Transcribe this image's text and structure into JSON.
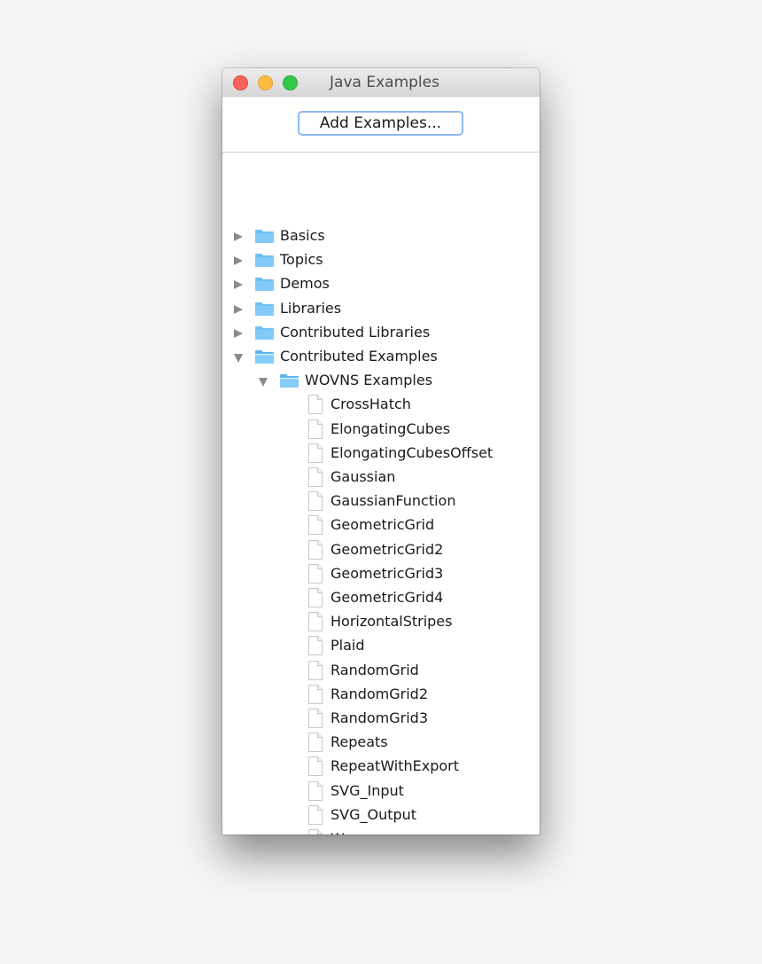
{
  "window": {
    "title": "Java Examples"
  },
  "toolbar": {
    "add_examples_label": "Add Examples..."
  },
  "tree": {
    "roots": [
      {
        "label": "Basics",
        "expanded": false
      },
      {
        "label": "Topics",
        "expanded": false
      },
      {
        "label": "Demos",
        "expanded": false
      },
      {
        "label": "Libraries",
        "expanded": false
      },
      {
        "label": "Contributed Libraries",
        "expanded": false
      },
      {
        "label": "Contributed Examples",
        "expanded": true
      }
    ],
    "subfolder": {
      "label": "WOVNS Examples",
      "expanded": true
    },
    "files": [
      "CrossHatch",
      "ElongatingCubes",
      "ElongatingCubesOffset",
      "Gaussian",
      "GaussianFunction",
      "GeometricGrid",
      "GeometricGrid2",
      "GeometricGrid3",
      "GeometricGrid4",
      "HorizontalStripes",
      "Plaid",
      "RandomGrid",
      "RandomGrid2",
      "RandomGrid3",
      "Repeats",
      "RepeatWithExport",
      "SVG_Input",
      "SVG_Output",
      "Wave"
    ]
  },
  "colors": {
    "close": "#fc605c",
    "minimize": "#fdbc40",
    "zoom": "#34c84a",
    "focus_ring": "#8cb8f2",
    "folder": "#7cc7f5"
  }
}
